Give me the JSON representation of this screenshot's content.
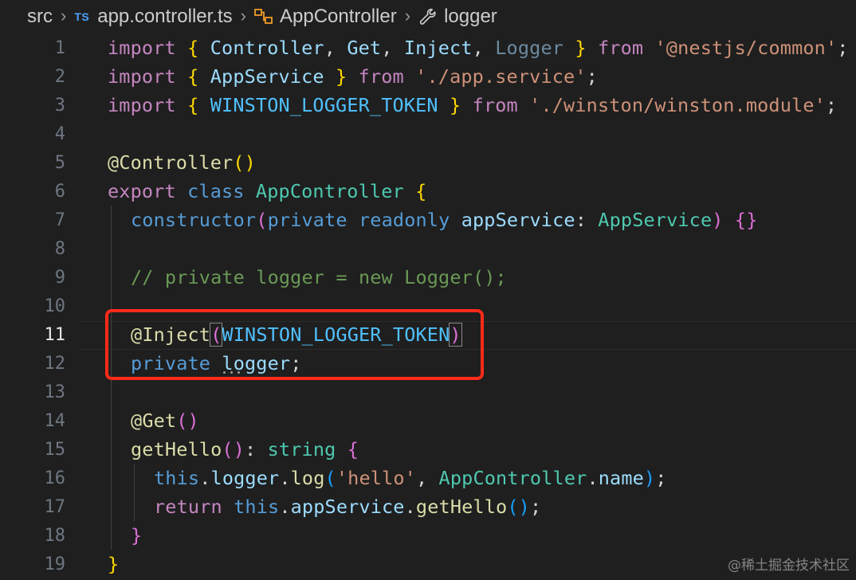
{
  "breadcrumb": {
    "folder": "src",
    "ts_badge": "TS",
    "file": "app.controller.ts",
    "class_name": "AppController",
    "member": "logger"
  },
  "line_numbers": [
    "1",
    "2",
    "3",
    "4",
    "5",
    "6",
    "7",
    "8",
    "9",
    "10",
    "11",
    "12",
    "13",
    "14",
    "15",
    "16",
    "17",
    "18",
    "19"
  ],
  "active_line": "11",
  "code": {
    "l1": [
      "import",
      " ",
      "{",
      " ",
      "Controller",
      ", ",
      "Get",
      ", ",
      "Inject",
      ", ",
      "Logger",
      " ",
      "}",
      " ",
      "from",
      " ",
      "'@nestjs/common'",
      ";"
    ],
    "l2": [
      "import",
      " ",
      "{",
      " ",
      "AppService",
      " ",
      "}",
      " ",
      "from",
      " ",
      "'./app.service'",
      ";"
    ],
    "l3": [
      "import",
      " ",
      "{",
      " ",
      "WINSTON_LOGGER_TOKEN",
      " ",
      "}",
      " ",
      "from",
      " ",
      "'./winston/winston.module'",
      ";"
    ],
    "l5": [
      "@",
      "Controller",
      "(",
      ")"
    ],
    "l6": [
      "export",
      " ",
      "class",
      " ",
      "AppController",
      " ",
      "{"
    ],
    "l7": [
      "constructor",
      "(",
      "private",
      " ",
      "readonly",
      " ",
      "appService",
      ": ",
      "AppService",
      ")",
      " ",
      "{}"
    ],
    "l9": [
      "// private logger = new Logger();"
    ],
    "l11": [
      "@",
      "Inject",
      "(",
      "WINSTON_LOGGER_TOKEN",
      ")"
    ],
    "l12": [
      "private",
      " ",
      "logger",
      ";"
    ],
    "l14": [
      "@",
      "Get",
      "(",
      ")"
    ],
    "l15": [
      "getHello",
      "(",
      ")",
      ": ",
      "string",
      " ",
      "{"
    ],
    "l16": [
      "this",
      ".",
      "logger",
      ".",
      "log",
      "(",
      "'hello'",
      ", ",
      "AppController",
      ".",
      "name",
      ")",
      ";"
    ],
    "l17": [
      "return",
      " ",
      "this",
      ".",
      "appService",
      ".",
      "getHello",
      "(",
      ")",
      ";"
    ],
    "l18": [
      "}"
    ],
    "l19": [
      "}"
    ]
  },
  "watermark": "@稀土掘金技术社区",
  "colors": {
    "background": "#1f1f1f",
    "keyword": "#c586c0",
    "storage": "#569cd6",
    "string": "#ce9178",
    "function": "#dcdcaa",
    "type": "#4ec9b0",
    "variable": "#9cdcfe",
    "constant": "#4fc1ff",
    "comment": "#6a9955",
    "bracket_gold": "#ffd700",
    "bracket_purple": "#da70d6",
    "bracket_blue": "#179fff",
    "highlight_box": "#ff2a1a"
  }
}
